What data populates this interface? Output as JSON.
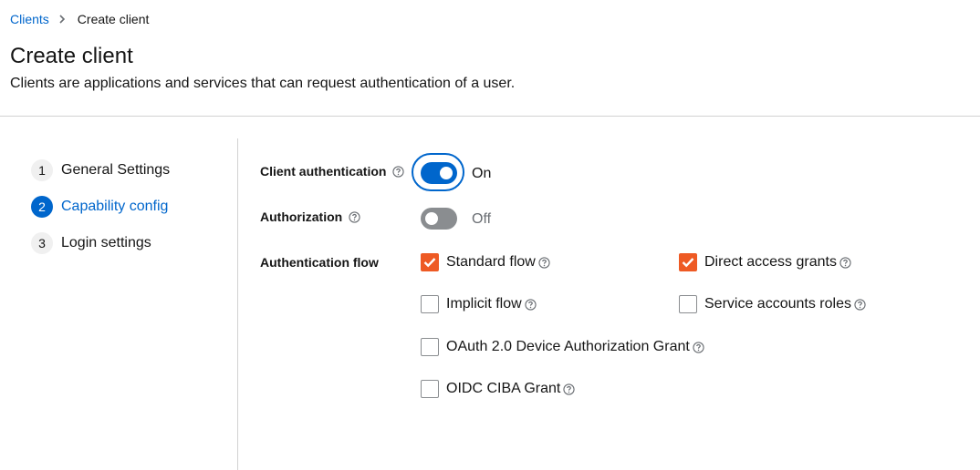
{
  "breadcrumb": {
    "parent": "Clients",
    "current": "Create client"
  },
  "header": {
    "title": "Create client",
    "description": "Clients are applications and services that can request authentication of a user."
  },
  "wizard": {
    "steps": [
      {
        "number": "1",
        "label": "General Settings",
        "active": false
      },
      {
        "number": "2",
        "label": "Capability config",
        "active": true
      },
      {
        "number": "3",
        "label": "Login settings",
        "active": false
      }
    ]
  },
  "form": {
    "client_auth": {
      "label": "Client authentication",
      "state": "On",
      "enabled": true
    },
    "authorization": {
      "label": "Authorization",
      "state": "Off",
      "enabled": false
    },
    "auth_flow": {
      "label": "Authentication flow",
      "options": [
        {
          "label": "Standard flow",
          "checked": true
        },
        {
          "label": "Direct access grants",
          "checked": true
        },
        {
          "label": "Implicit flow",
          "checked": false
        },
        {
          "label": "Service accounts roles",
          "checked": false
        },
        {
          "label": "OAuth 2.0 Device Authorization Grant",
          "checked": false
        },
        {
          "label": "OIDC CIBA Grant",
          "checked": false
        }
      ]
    }
  },
  "colors": {
    "primary": "#0066cc",
    "checkbox_checked": "#ee5a24",
    "switch_off": "#8a8d90",
    "text": "#151515"
  },
  "icons": {
    "help": "question-circle-icon",
    "breadcrumb_separator": "angle-right-icon",
    "check": "checkmark-icon"
  }
}
